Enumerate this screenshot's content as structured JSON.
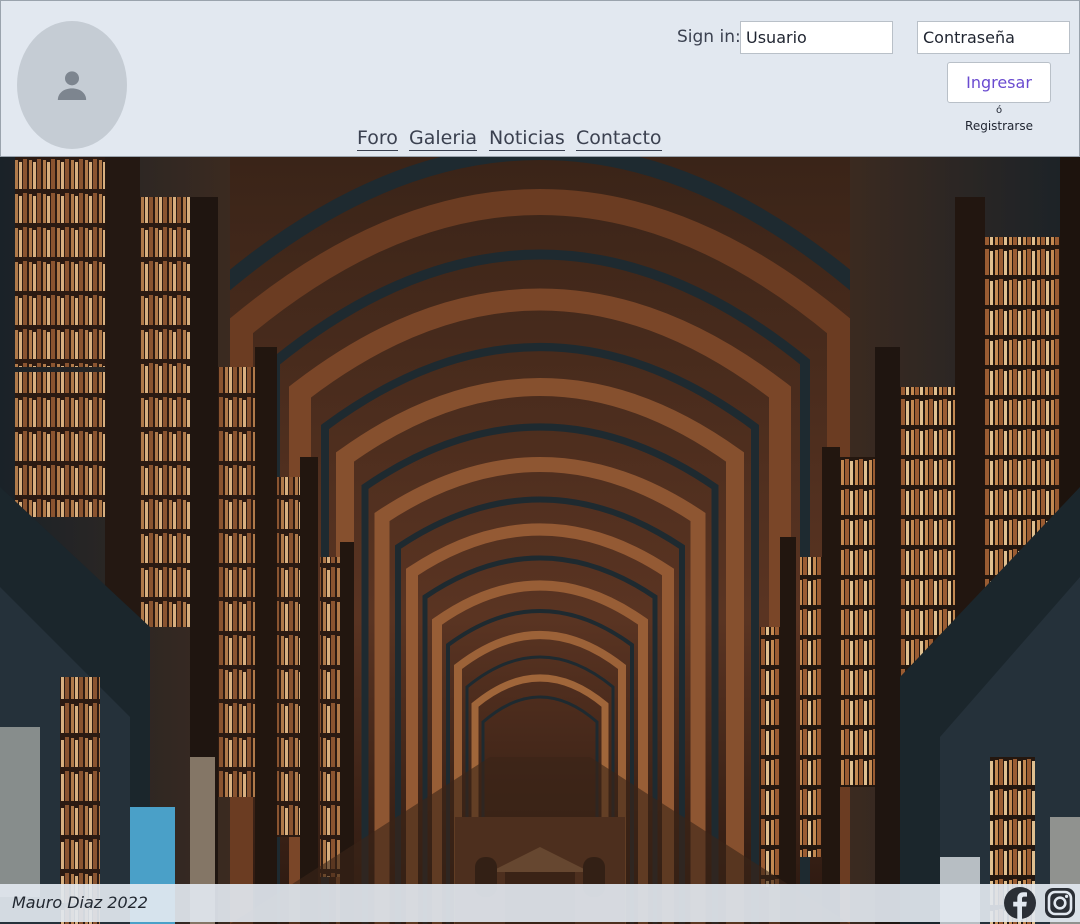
{
  "header": {
    "signin_label": "Sign in:",
    "username_placeholder": "Usuario",
    "password_placeholder": "Contraseña",
    "login_button": "Ingresar",
    "or_text": "ó",
    "register_link": "Registrarse"
  },
  "nav": {
    "items": [
      {
        "label": "Foro"
      },
      {
        "label": "Galeria"
      },
      {
        "label": "Noticias"
      },
      {
        "label": "Contacto"
      }
    ]
  },
  "footer": {
    "copyright": "Mauro Diaz 2022",
    "social": [
      "facebook-icon",
      "instagram-icon"
    ]
  },
  "colors": {
    "header_bg": "#e2e8f0",
    "login_text": "#6a4bd0",
    "nav_text": "#3b4150"
  }
}
